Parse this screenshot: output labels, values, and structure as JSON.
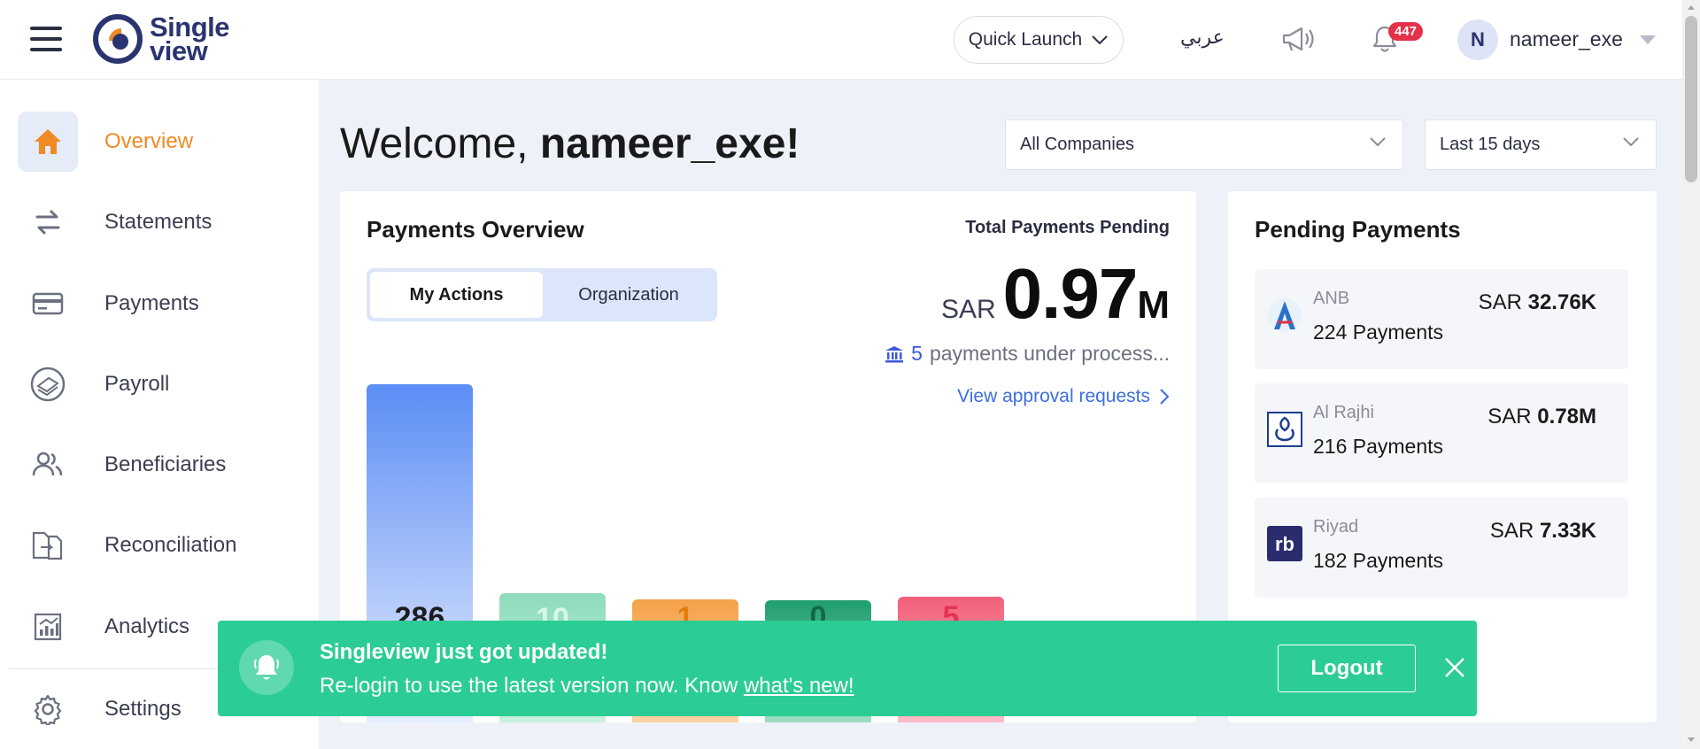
{
  "header": {
    "logo_line1": "Single",
    "logo_line2": "view",
    "quick_launch": "Quick Launch",
    "language": "عربي",
    "notification_count": "447",
    "avatar_initial": "N",
    "username": "nameer_exe"
  },
  "sidebar": {
    "items": [
      {
        "label": "Overview",
        "icon": "home-icon",
        "active": true
      },
      {
        "label": "Statements",
        "icon": "transfer-arrows-icon"
      },
      {
        "label": "Payments",
        "icon": "card-icon"
      },
      {
        "label": "Payroll",
        "icon": "money-stack-icon"
      },
      {
        "label": "Beneficiaries",
        "icon": "users-icon"
      },
      {
        "label": "Reconciliation",
        "icon": "documents-compare-icon"
      },
      {
        "label": "Analytics",
        "icon": "chart-icon"
      },
      {
        "label": "Settings",
        "icon": "gear-icon"
      }
    ]
  },
  "main": {
    "welcome_prefix": "Welcome, ",
    "welcome_name": "nameer_exe!",
    "company_filter": "All Companies",
    "date_filter": "Last 15 days"
  },
  "payments_overview": {
    "title": "Payments Overview",
    "tabs": [
      "My Actions",
      "Organization"
    ],
    "total_label": "Total Payments Pending",
    "total_currency": "SAR",
    "total_value": "0.97",
    "total_unit": "M",
    "processing_count": "5",
    "processing_text": "payments under process...",
    "approval_link": "View approval requests",
    "bars": [
      {
        "value": "286",
        "color": "#5b8df5",
        "text_color": "#3f6fe8"
      },
      {
        "value": "10",
        "color": "#8fdcbc",
        "text_color": "#ffffff"
      },
      {
        "value": "1",
        "color": "#f5a24a",
        "text_color": "#e37c10"
      },
      {
        "value": "0",
        "color": "#1f9e6e",
        "text_color": "#0f6a47"
      },
      {
        "value": "5",
        "color": "#f2607a",
        "text_color": "#e23355"
      }
    ]
  },
  "pending_payments": {
    "title": "Pending Payments",
    "items": [
      {
        "bank": "ANB",
        "count": "224 Payments",
        "currency": "SAR",
        "amount": "32.76K",
        "logo": "anb-logo-icon"
      },
      {
        "bank": "Al Rajhi",
        "count": "216 Payments",
        "currency": "SAR",
        "amount": "0.78M",
        "logo": "alrajhi-logo-icon"
      },
      {
        "bank": "Riyad",
        "count": "182 Payments",
        "currency": "SAR",
        "amount": "7.33K",
        "logo": "riyad-logo-icon"
      }
    ]
  },
  "toast": {
    "title": "Singleview just got updated!",
    "message": "Re-login to use the latest version now. Know ",
    "link": "what's new!",
    "button": "Logout"
  }
}
